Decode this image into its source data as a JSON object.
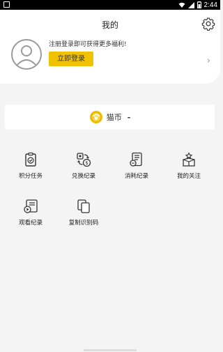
{
  "status_bar": {
    "time": "2:44",
    "icons": [
      "wifi-icon",
      "signal-icon",
      "battery-icon"
    ]
  },
  "header": {
    "title": "我的",
    "settings_icon": "gear-icon"
  },
  "profile": {
    "avatar_icon": "user-avatar-icon",
    "promo_text": "注册登录即可获得更多福利!",
    "login_label": "立即登录",
    "chevron": "›"
  },
  "coins": {
    "icon": "coin-icon",
    "label": "猫币",
    "value": "-"
  },
  "menu": {
    "items": [
      {
        "label": "积分任务",
        "icon": "clipboard-check-icon"
      },
      {
        "label": "兑换纪录",
        "icon": "exchange-icon"
      },
      {
        "label": "消耗纪录",
        "icon": "receipt-icon"
      },
      {
        "label": "我的关注",
        "icon": "gift-box-icon"
      },
      {
        "label": "观看纪录",
        "icon": "play-history-icon"
      },
      {
        "label": "复制识别码",
        "icon": "copy-icon"
      }
    ]
  },
  "colors": {
    "accent": "#f2c200",
    "page_bg": "#f4f4f4"
  }
}
